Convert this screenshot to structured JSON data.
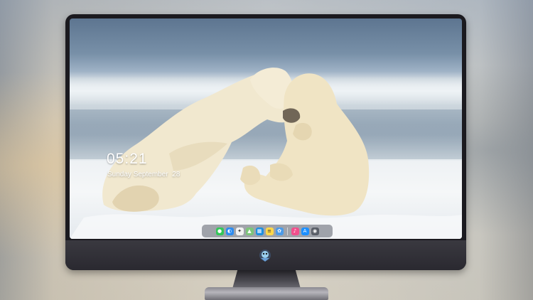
{
  "lock_screen": {
    "time": "05:21",
    "date": "Sunday September  28"
  },
  "dock": {
    "apps": [
      {
        "icon": "messages-icon",
        "color": "#34c759",
        "glyph": "●"
      },
      {
        "icon": "finder-icon",
        "color": "#2d8cf0",
        "glyph": "◐"
      },
      {
        "icon": "safari-icon",
        "color": "#f2f2f2",
        "glyph": "✦"
      },
      {
        "icon": "maps-icon",
        "color": "#7dc57a",
        "glyph": "▲"
      },
      {
        "icon": "clapper-icon",
        "color": "#1f8fe0",
        "glyph": "▦"
      },
      {
        "icon": "notes-icon",
        "color": "#ffd84a",
        "glyph": "≡"
      },
      {
        "icon": "photos-icon",
        "color": "#4c9be8",
        "glyph": "✿"
      },
      {
        "icon": "music-icon",
        "color": "#f0508c",
        "glyph": "♪"
      },
      {
        "icon": "app-store-icon",
        "color": "#1e90ff",
        "glyph": "A"
      },
      {
        "icon": "camera-icon",
        "color": "#5a5f68",
        "glyph": "◉"
      }
    ]
  },
  "colors": {
    "monitor_bezel": "#1b1a1f",
    "chin": "#2a2930",
    "dock_background": "#5a5f69"
  }
}
